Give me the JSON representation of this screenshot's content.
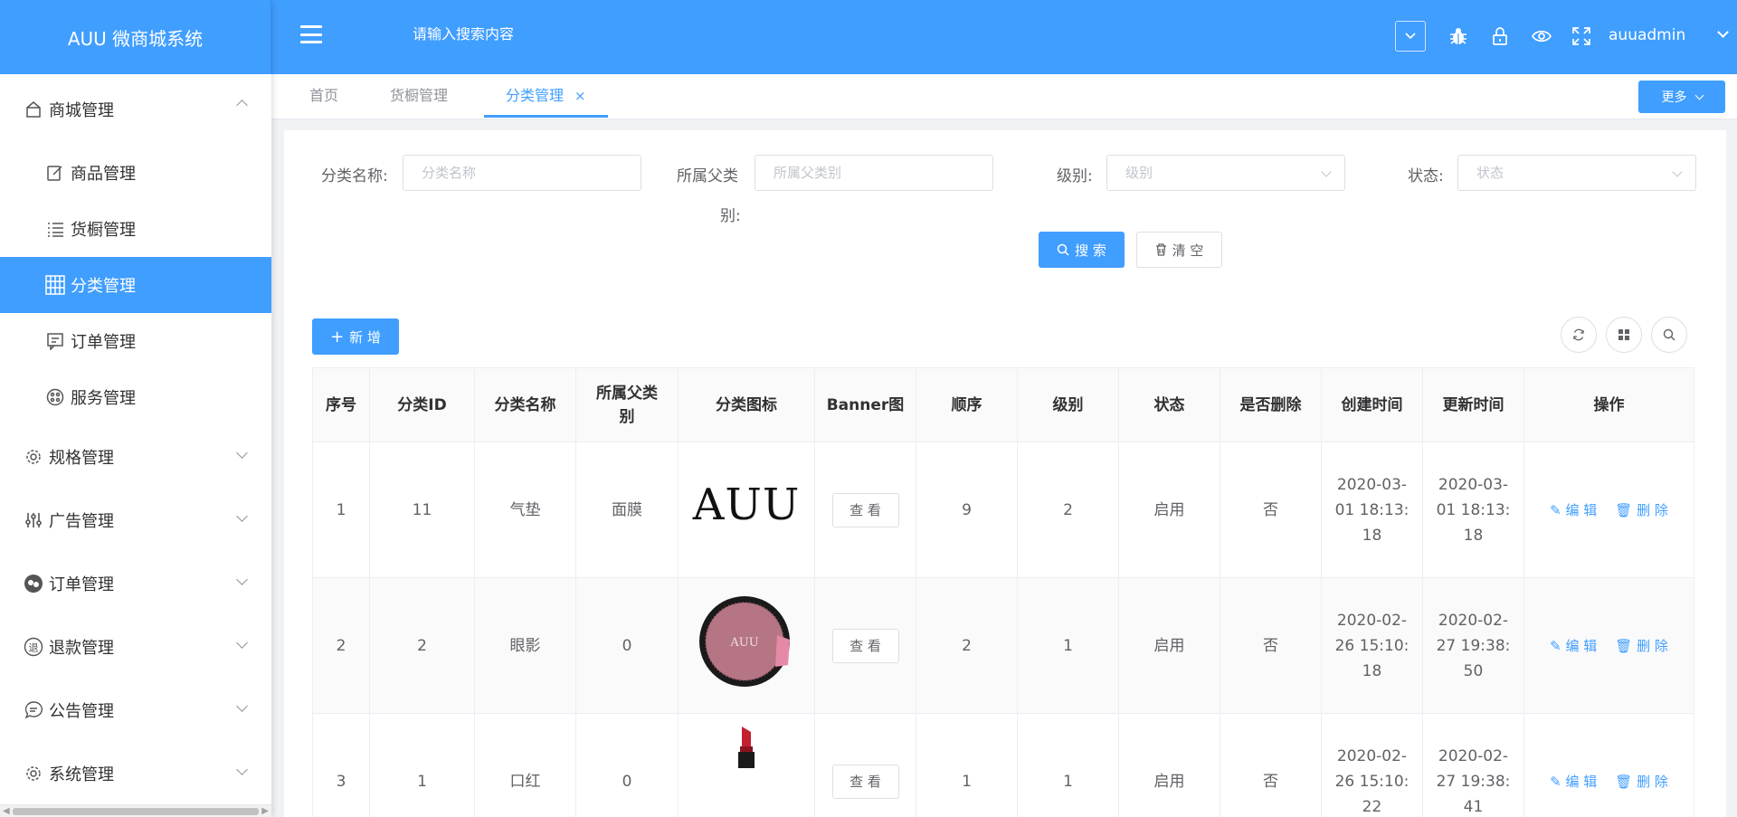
{
  "app": {
    "title": "AUU 微商城系统"
  },
  "header": {
    "search_placeholder": "请输入搜索内容",
    "username": "auuadmin"
  },
  "sidebar": {
    "groups": [
      {
        "label": "商城管理",
        "expanded": true
      },
      {
        "label": "规格管理"
      },
      {
        "label": "广告管理"
      },
      {
        "label": "订单管理"
      },
      {
        "label": "退款管理"
      },
      {
        "label": "公告管理"
      },
      {
        "label": "系统管理"
      }
    ],
    "subitems": [
      {
        "label": "商品管理"
      },
      {
        "label": "货橱管理"
      },
      {
        "label": "分类管理",
        "active": true
      },
      {
        "label": "订单管理"
      },
      {
        "label": "服务管理"
      }
    ]
  },
  "tabs": [
    {
      "label": "首页"
    },
    {
      "label": "货橱管理"
    },
    {
      "label": "分类管理",
      "active": true,
      "close": "×"
    }
  ],
  "more_label": "更多",
  "filters": {
    "name_label": "分类名称:",
    "name_placeholder": "分类名称",
    "parent_label_1": "所属父类",
    "parent_label_2": "别:",
    "parent_placeholder": "所属父类别",
    "level_label": "级别:",
    "level_placeholder": "级别",
    "status_label": "状态:",
    "status_placeholder": "状态",
    "search_btn": "搜 索",
    "clear_btn": "清 空"
  },
  "add_btn": "新 增",
  "table": {
    "columns": [
      "序号",
      "分类ID",
      "分类名称",
      "所属父类别",
      "分类图标",
      "Banner图",
      "顺序",
      "级别",
      "状态",
      "是否删除",
      "创建时间",
      "更新时间",
      "操作"
    ],
    "view_label": "查 看",
    "edit_label": "编 辑",
    "delete_label": "删 除",
    "rows": [
      {
        "no": "1",
        "id": "11",
        "name": "气垫",
        "parent": "面膜",
        "icon": "auu-text-logo",
        "order": "9",
        "level": "2",
        "status": "启用",
        "deleted": "否",
        "created": "2020-03-01 18:13:18",
        "updated": "2020-03-01 18:13:18"
      },
      {
        "no": "2",
        "id": "2",
        "name": "眼影",
        "parent": "0",
        "icon": "eyeshadow-compact",
        "order": "2",
        "level": "1",
        "status": "启用",
        "deleted": "否",
        "created": "2020-02-26 15:10:18",
        "updated": "2020-02-27 19:38:50"
      },
      {
        "no": "3",
        "id": "1",
        "name": "口红",
        "parent": "0",
        "icon": "lipstick",
        "order": "1",
        "level": "1",
        "status": "启用",
        "deleted": "否",
        "created": "2020-02-26 15:10:22",
        "updated": "2020-02-27 19:38:41"
      }
    ]
  },
  "icon_text": {
    "auu": "AUU"
  },
  "colors": {
    "primary": "#409eff"
  }
}
